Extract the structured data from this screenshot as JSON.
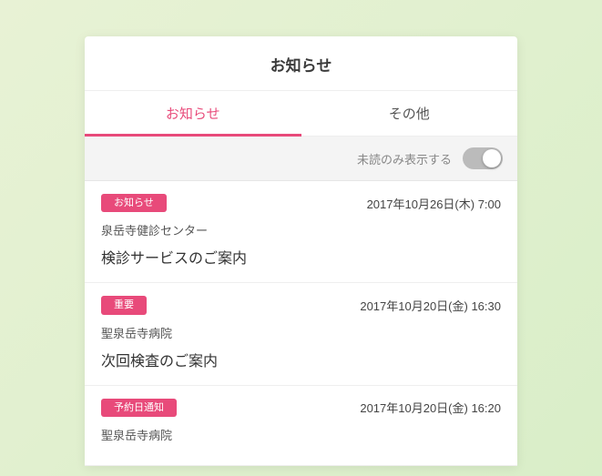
{
  "header": {
    "title": "お知らせ"
  },
  "tabs": {
    "items": [
      {
        "label": "お知らせ",
        "active": true
      },
      {
        "label": "その他",
        "active": false
      }
    ]
  },
  "filter": {
    "label": "未読のみ表示する",
    "enabled": false
  },
  "colors": {
    "accent": "#e84a7a"
  },
  "notifications": [
    {
      "badge": "お知らせ",
      "timestamp": "2017年10月26日(木) 7:00",
      "sender": "泉岳寺健診センター",
      "subject": "検診サービスのご案内"
    },
    {
      "badge": "重要",
      "timestamp": "2017年10月20日(金) 16:30",
      "sender": "聖泉岳寺病院",
      "subject": "次回検査のご案内"
    },
    {
      "badge": "予約日通知",
      "timestamp": "2017年10月20日(金) 16:20",
      "sender": "聖泉岳寺病院",
      "subject": ""
    }
  ]
}
